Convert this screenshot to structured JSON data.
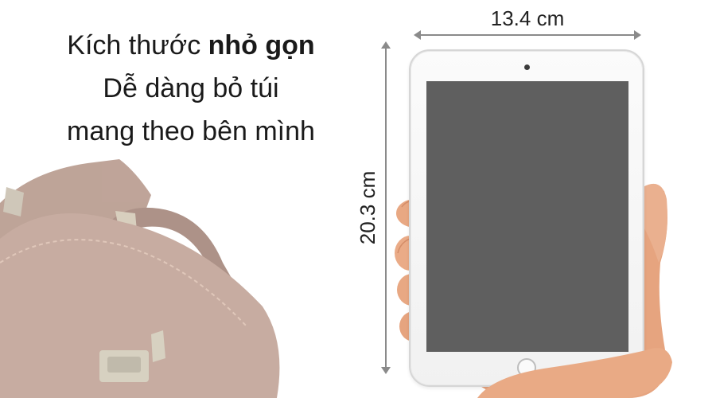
{
  "headline": {
    "line1_regular": "Kích thước ",
    "line1_bold": "nhỏ gọn",
    "line2": "Dễ dàng bỏ túi",
    "line3": "mang theo bên mình"
  },
  "dimensions": {
    "width_label": "13.4 cm",
    "height_label": "20.3 cm"
  },
  "colors": {
    "screen": "#5f5f5f",
    "bag": "#7a4a36",
    "skin": "#e9a884",
    "dimension_line": "#8a8a8a"
  },
  "icons": {
    "camera": "front-camera-icon",
    "home": "home-button-icon"
  }
}
